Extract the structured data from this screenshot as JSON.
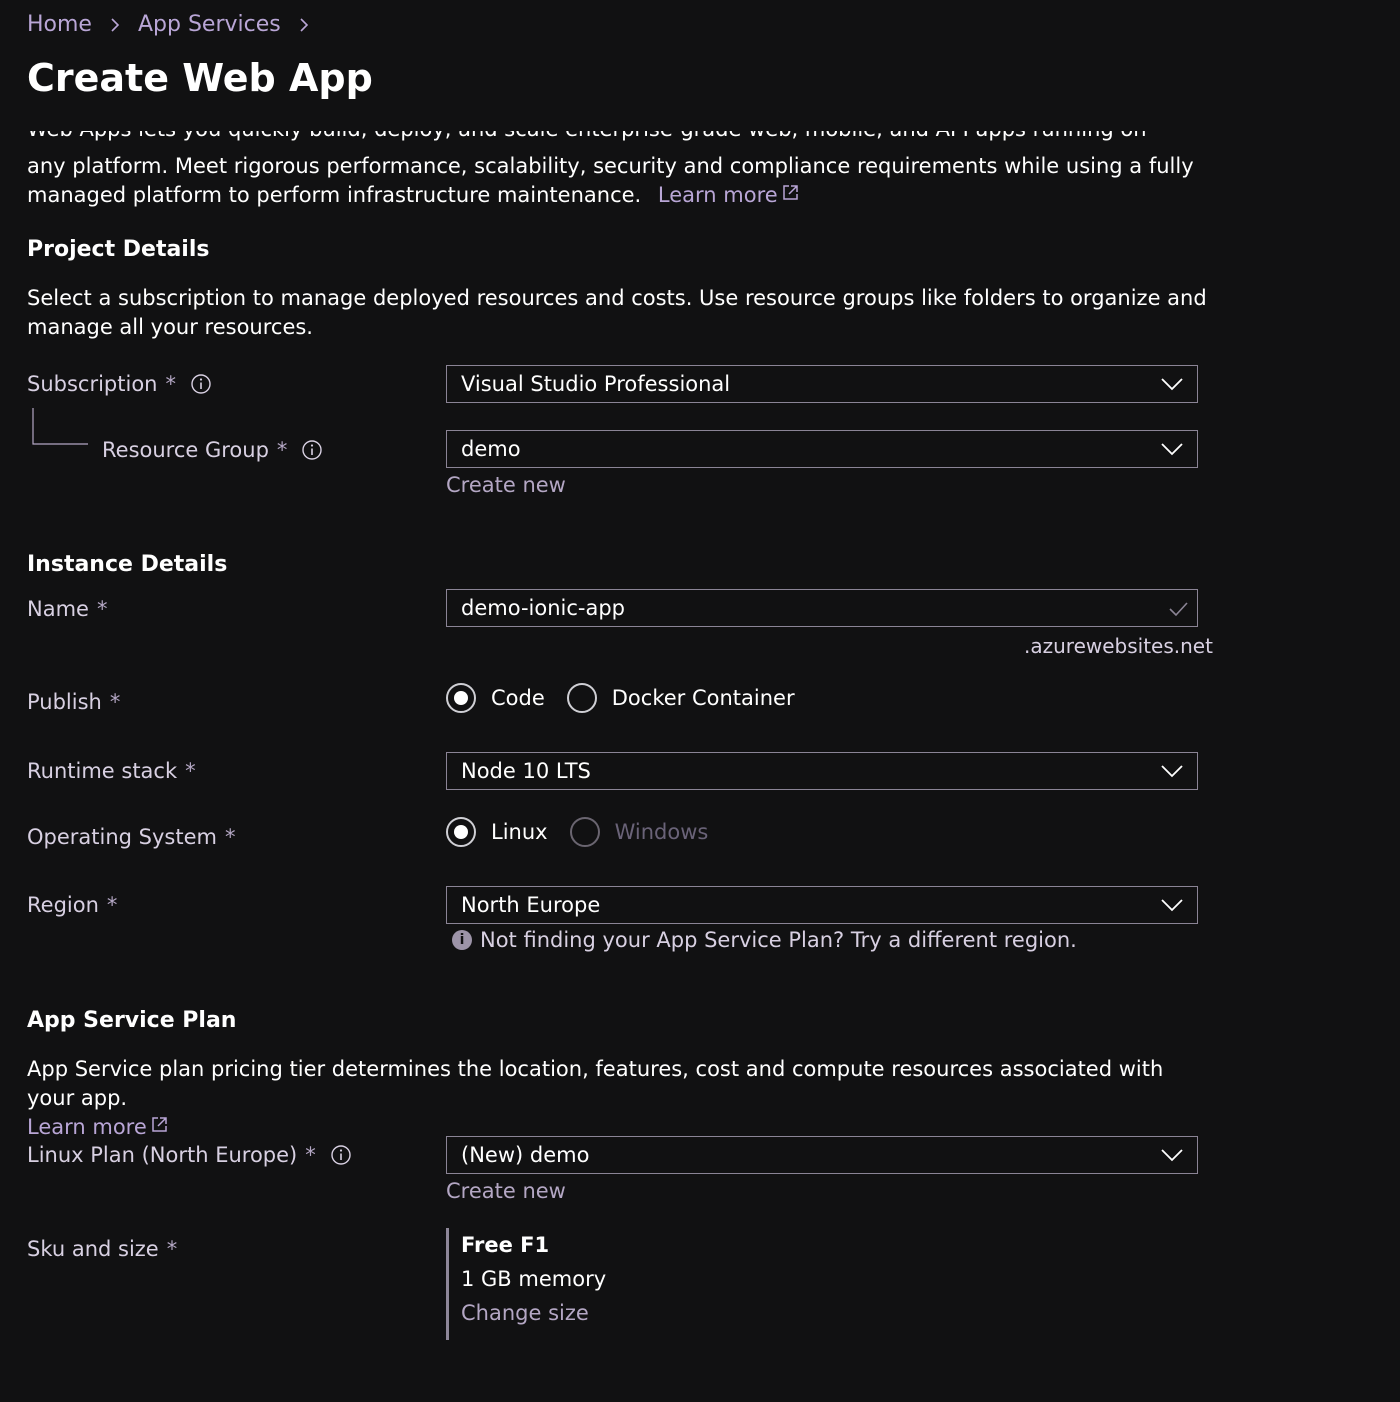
{
  "breadcrumb": {
    "items": [
      "Home",
      "App Services"
    ]
  },
  "page_title": "Create Web App",
  "intro": {
    "cut_line": "Web Apps lets you quickly build, deploy, and scale enterprise-grade web, mobile, and API apps running on",
    "text": "any platform. Meet rigorous performance, scalability, security and compliance requirements while using a fully managed platform to perform infrastructure maintenance.",
    "learn_more": "Learn more"
  },
  "project": {
    "heading": "Project Details",
    "description": "Select a subscription to manage deployed resources and costs. Use resource groups like folders to organize and manage all your resources.",
    "subscription_label": "Subscription",
    "subscription_value": "Visual Studio Professional",
    "resource_group_label": "Resource Group",
    "resource_group_value": "demo",
    "create_new": "Create new"
  },
  "instance": {
    "heading": "Instance Details",
    "name_label": "Name",
    "name_value": "demo-ionic-app",
    "name_suffix": ".azurewebsites.net",
    "publish_label": "Publish",
    "publish_options": [
      "Code",
      "Docker Container"
    ],
    "runtime_label": "Runtime stack",
    "runtime_value": "Node 10 LTS",
    "os_label": "Operating System",
    "os_options": [
      "Linux",
      "Windows"
    ],
    "region_label": "Region",
    "region_value": "North Europe",
    "region_hint": "Not finding your App Service Plan? Try a different region."
  },
  "plan": {
    "heading": "App Service Plan",
    "description": "App Service plan pricing tier determines the location, features, cost and compute resources associated with your app.",
    "learn_more": "Learn more",
    "linux_plan_label": "Linux Plan (North Europe)",
    "linux_plan_value": "(New) demo",
    "create_new": "Create new",
    "sku_label": "Sku and size",
    "sku_name": "Free F1",
    "sku_memory": "1 GB memory",
    "change_size": "Change size"
  },
  "required_mark": "*",
  "icons": {
    "chevron": "chevron-down-icon",
    "info": "info-icon",
    "check": "check-icon",
    "external": "external-link-icon",
    "hint": "info-filled-icon",
    "hint_glyph": "i"
  }
}
